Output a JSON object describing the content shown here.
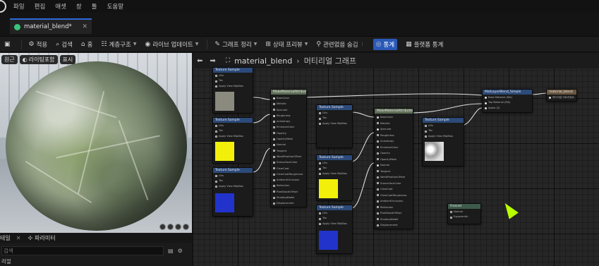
{
  "menu": [
    "파일",
    "편집",
    "애셋",
    "창",
    "툴",
    "도움말"
  ],
  "tab": {
    "label": "material_blend*"
  },
  "toolbar": {
    "apply": "적용",
    "search": "검색",
    "home": "홈",
    "hierarchy": "계층구조",
    "live_update": "라이브 업데이트",
    "clean_graph": "그래프 정리",
    "state_preview": "상태 프리뷰",
    "hide_unrelated": "관련없음 숨김",
    "stats": "통계",
    "platform_stats": "플랫폼 통계"
  },
  "viewport": {
    "chips": [
      "원근",
      "라이팅포함",
      "표시"
    ]
  },
  "details": {
    "tabs": [
      "테일",
      "파라미터"
    ],
    "search_placeholder": "검색",
    "section": "리얼"
  },
  "graph": {
    "breadcrumb": {
      "asset": "material_blend",
      "current": "머티리얼 그래프"
    },
    "nodes": {
      "tex_top": {
        "title": "Texture Sample",
        "pins": [
          "UVs",
          "Tex",
          "Apply View MipBias"
        ],
        "outs": [
          "RGB",
          "R",
          "G",
          "B",
          "A",
          "RGBA"
        ],
        "color": "#8a8a7e"
      },
      "tex_yellow_1": {
        "title": "Texture Sample",
        "pins": [
          "UVs",
          "Tex",
          "Apply View MipBias"
        ],
        "outs": [
          "RGB",
          "R",
          "G",
          "B",
          "A",
          "RGBA"
        ],
        "color": "#f2f00a"
      },
      "tex_blue_1": {
        "title": "Texture Sample",
        "pins": [
          "UVs",
          "Tex",
          "Apply View MipBias"
        ],
        "outs": [
          "RGB",
          "R",
          "G",
          "B",
          "A",
          "RGBA"
        ],
        "color": "#2233cc"
      },
      "make_mat_1": {
        "title": "MakeMaterialAttributes",
        "pins": [
          "BaseColor",
          "Metallic",
          "Specular",
          "Roughness",
          "Anisotropy",
          "EmissiveColor",
          "Opacity",
          "OpacityMask",
          "Normal",
          "Tangent",
          "WorldPositionOffset",
          "SubsurfaceColor",
          "ClearCoat",
          "ClearCoatRoughness",
          "AmbientOcclusion",
          "Refraction",
          "PixelDepthOffset",
          "ShadingModel",
          "Displacement"
        ]
      },
      "tex_gray_2": {
        "title": "Texture Sample",
        "pins": [
          "UVs",
          "Tex",
          "Apply View MipBias"
        ],
        "outs": [
          "RGB",
          "R",
          "G",
          "B",
          "A",
          "RGBA"
        ],
        "color": "#4a4a46"
      },
      "tex_yellow_2": {
        "title": "Texture Sample",
        "pins": [
          "UVs",
          "Tex",
          "Apply View MipBias"
        ],
        "outs": [
          "RGB",
          "R",
          "G",
          "B",
          "A",
          "RGBA"
        ],
        "color": "#f2f00a"
      },
      "tex_blue_2": {
        "title": "Texture Sample",
        "pins": [
          "UVs",
          "Tex",
          "Apply View MipBias"
        ],
        "outs": [
          "RGB",
          "R",
          "G",
          "B",
          "A",
          "RGBA"
        ],
        "color": "#2233cc"
      },
      "make_mat_2": {
        "title": "MakeMaterialAttributes",
        "pins": [
          "BaseColor",
          "Metallic",
          "Specular",
          "Roughness",
          "Anisotropy",
          "EmissiveColor",
          "Opacity",
          "OpacityMask",
          "Normal",
          "Tangent",
          "WorldPositionOffset",
          "SubsurfaceColor",
          "ClearCoat",
          "ClearCoatRoughness",
          "AmbientOcclusion",
          "Refraction",
          "PixelDepthOffset",
          "ShadingModel",
          "Displacement"
        ]
      },
      "tex_noise": {
        "title": "Texture Sample",
        "pins": [
          "UVs",
          "Tex",
          "Apply View MipBias"
        ],
        "outs": [
          "RGB",
          "R",
          "G",
          "B",
          "A",
          "RGBA"
        ],
        "color": "#cfcfcf"
      },
      "blend": {
        "title": "MatLayerBlend_Simple",
        "pins": [
          "Base Material (MA)",
          "Top Material (MA)",
          "Alpha (S)"
        ],
        "outs": [
          "Blended Material"
        ]
      },
      "result": {
        "title": "material_blend",
        "pins": [
          "머티리얼 어트리뷰트"
        ]
      },
      "fresnel": {
        "title": "Fresnel",
        "pins": [
          "Normal",
          "ExponentIn",
          "BaseReflectFraction"
        ],
        "outs": []
      }
    }
  },
  "colors": {
    "accent": "#2a59b8",
    "tab_dot": "#39c47a",
    "cursor": "#b8ff00"
  }
}
